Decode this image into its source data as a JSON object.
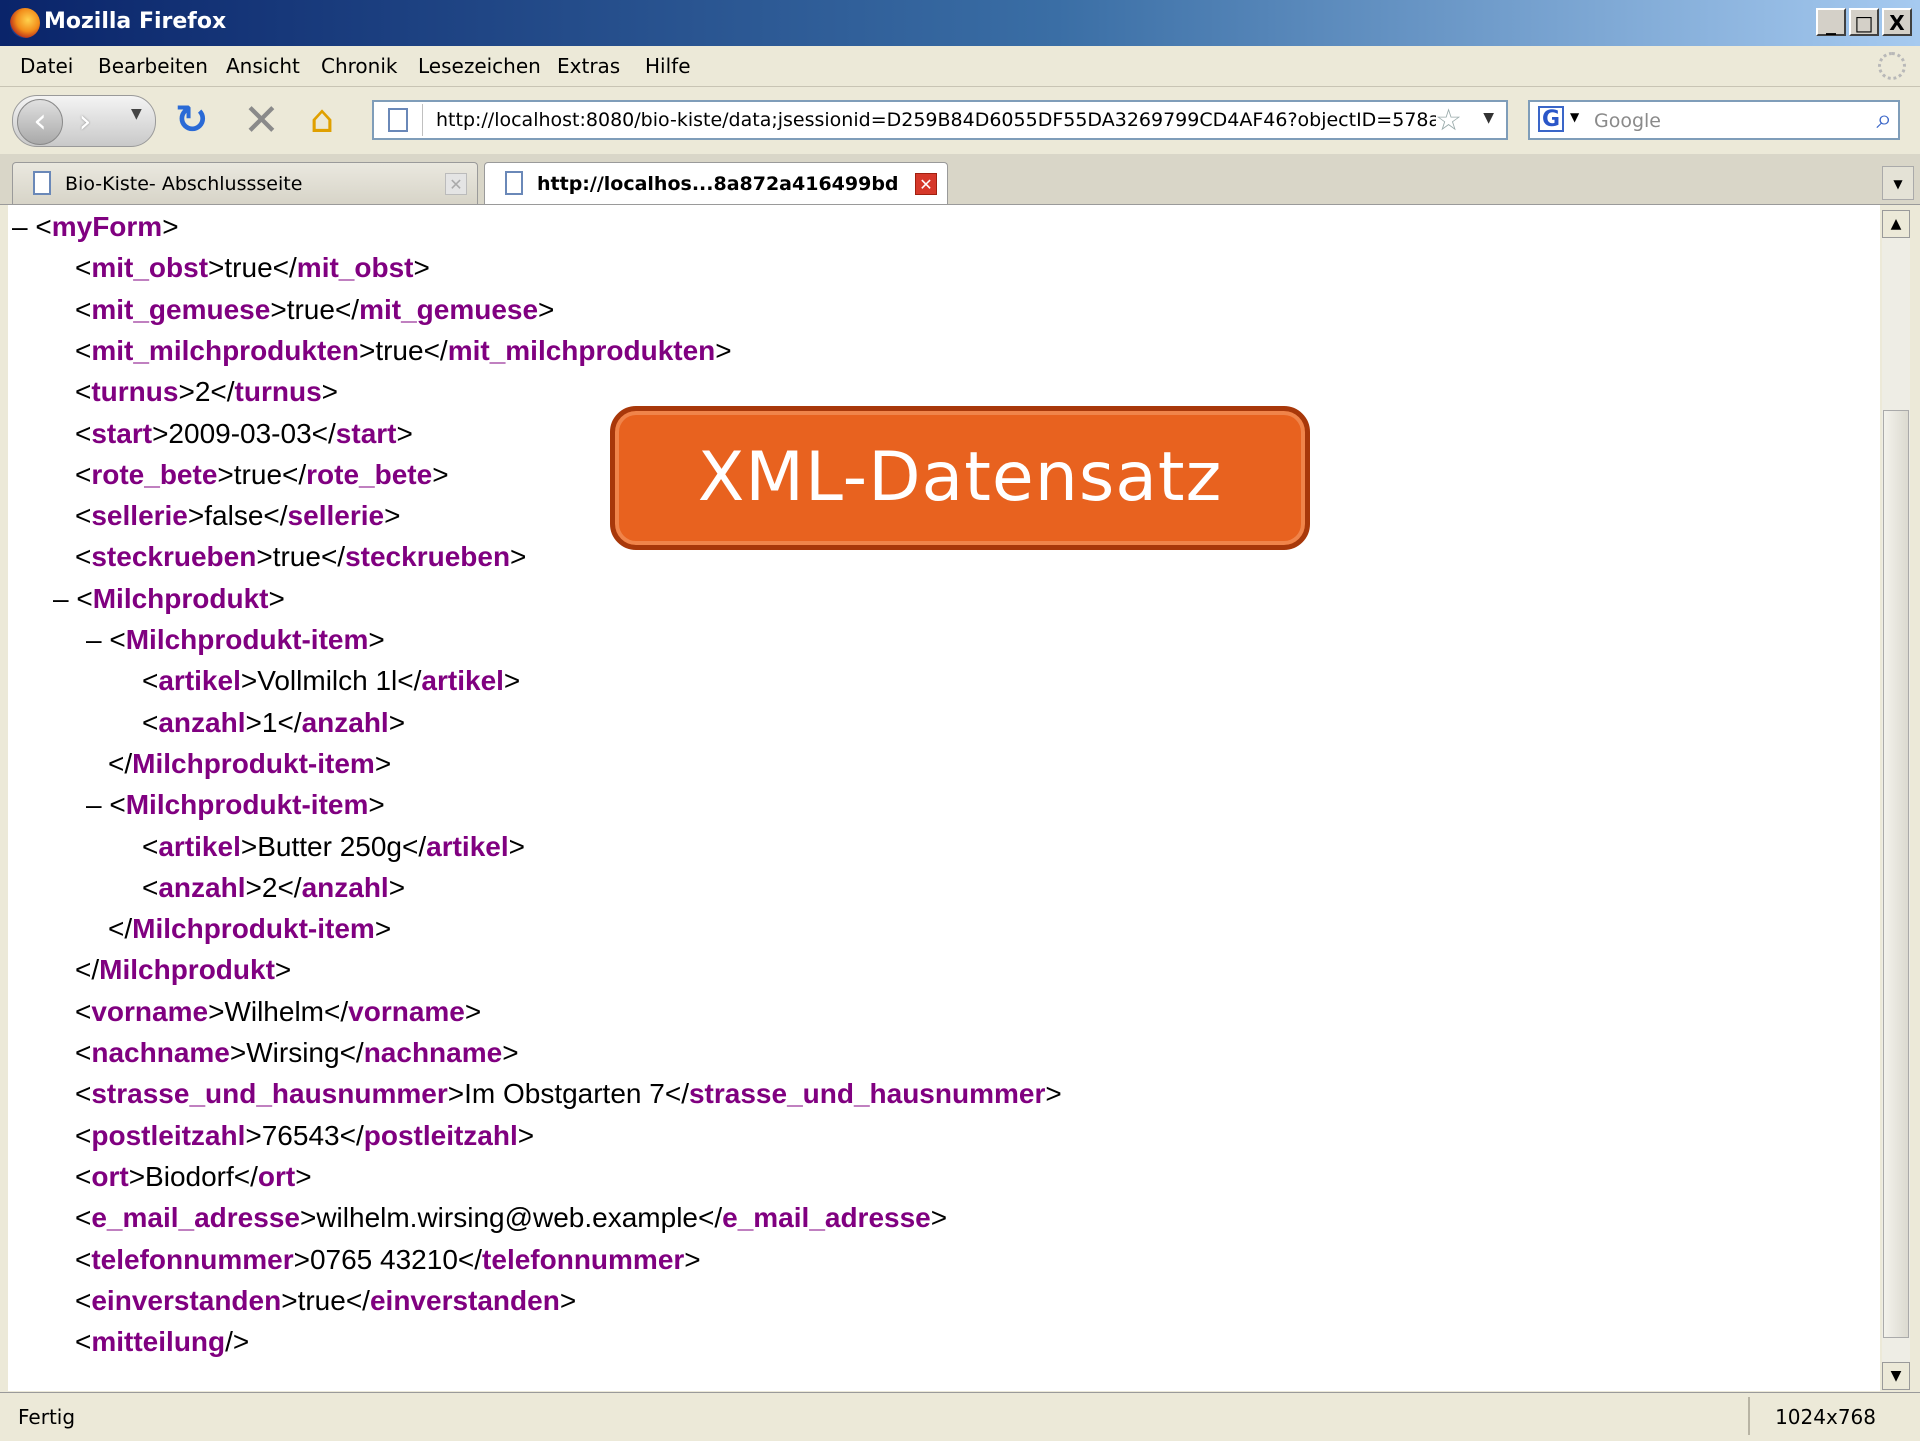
{
  "window": {
    "title": "Mozilla Firefox",
    "buttons": [
      "_",
      "□",
      "X"
    ]
  },
  "menu": {
    "items": [
      "Datei",
      "Bearbeiten",
      "Ansicht",
      "Chronik",
      "Lesezeichen",
      "Extras",
      "Hilfe"
    ]
  },
  "nav": {
    "url": "http://localhost:8080/bio-kiste/data;jsessionid=D259B84D6055DF55DA3269799CD4AF46?objectID=578a872a",
    "search_placeholder": "Google",
    "icons": [
      "back-icon",
      "forward-icon",
      "reload-icon",
      "stop-icon",
      "home-icon",
      "bookmark-star-icon",
      "google-icon",
      "search-icon"
    ]
  },
  "tabs": [
    {
      "label": "Bio-Kiste- Abschlussseite",
      "active": false
    },
    {
      "label": "http://localhos...8a872a416499bd",
      "active": true
    }
  ],
  "xml": [
    {
      "indent": 0,
      "toggle": "–",
      "open": "myForm"
    },
    {
      "indent": 1,
      "tag": "mit_obst",
      "value": "true"
    },
    {
      "indent": 1,
      "tag": "mit_gemuese",
      "value": "true"
    },
    {
      "indent": 1,
      "tag": "mit_milchprodukten",
      "value": "true"
    },
    {
      "indent": 1,
      "tag": "turnus",
      "value": "2"
    },
    {
      "indent": 1,
      "tag": "start",
      "value": "2009-03-03"
    },
    {
      "indent": 1,
      "tag": "rote_bete",
      "value": "true"
    },
    {
      "indent": 1,
      "tag": "sellerie",
      "value": "false"
    },
    {
      "indent": 1,
      "tag": "steckrueben",
      "value": "true"
    },
    {
      "indent": 1,
      "toggle": "–",
      "open": "Milchprodukt"
    },
    {
      "indent": 2,
      "toggle": "–",
      "open": "Milchprodukt-item"
    },
    {
      "indent": 3,
      "tag": "artikel",
      "value": "Vollmilch 1l"
    },
    {
      "indent": 3,
      "tag": "anzahl",
      "value": "1"
    },
    {
      "indent": 2,
      "close": "Milchprodukt-item"
    },
    {
      "indent": 2,
      "toggle": "–",
      "open": "Milchprodukt-item"
    },
    {
      "indent": 3,
      "tag": "artikel",
      "value": "Butter 250g"
    },
    {
      "indent": 3,
      "tag": "anzahl",
      "value": "2"
    },
    {
      "indent": 2,
      "close": "Milchprodukt-item"
    },
    {
      "indent": 1,
      "close": "Milchprodukt"
    },
    {
      "indent": 1,
      "tag": "vorname",
      "value": "Wilhelm"
    },
    {
      "indent": 1,
      "tag": "nachname",
      "value": "Wirsing"
    },
    {
      "indent": 1,
      "tag": "strasse_und_hausnummer",
      "value": "Im Obstgarten 7"
    },
    {
      "indent": 1,
      "tag": "postleitzahl",
      "value": "76543"
    },
    {
      "indent": 1,
      "tag": "ort",
      "value": "Biodorf"
    },
    {
      "indent": 1,
      "tag": "e_mail_adresse",
      "value": "wilhelm.wirsing@web.example"
    },
    {
      "indent": 1,
      "tag": "telefonnummer",
      "value": "0765 43210"
    },
    {
      "indent": 1,
      "tag": "einverstanden",
      "value": "true"
    },
    {
      "indent": 1,
      "selfclose": "mitteilung"
    }
  ],
  "overlay": {
    "label": "XML-Datensatz"
  },
  "status": {
    "text": "Fertig",
    "resolution": "1024x768"
  },
  "colors": {
    "tag": "#800080",
    "overlay": "#e8621f",
    "titlebar": "#0a246a"
  }
}
